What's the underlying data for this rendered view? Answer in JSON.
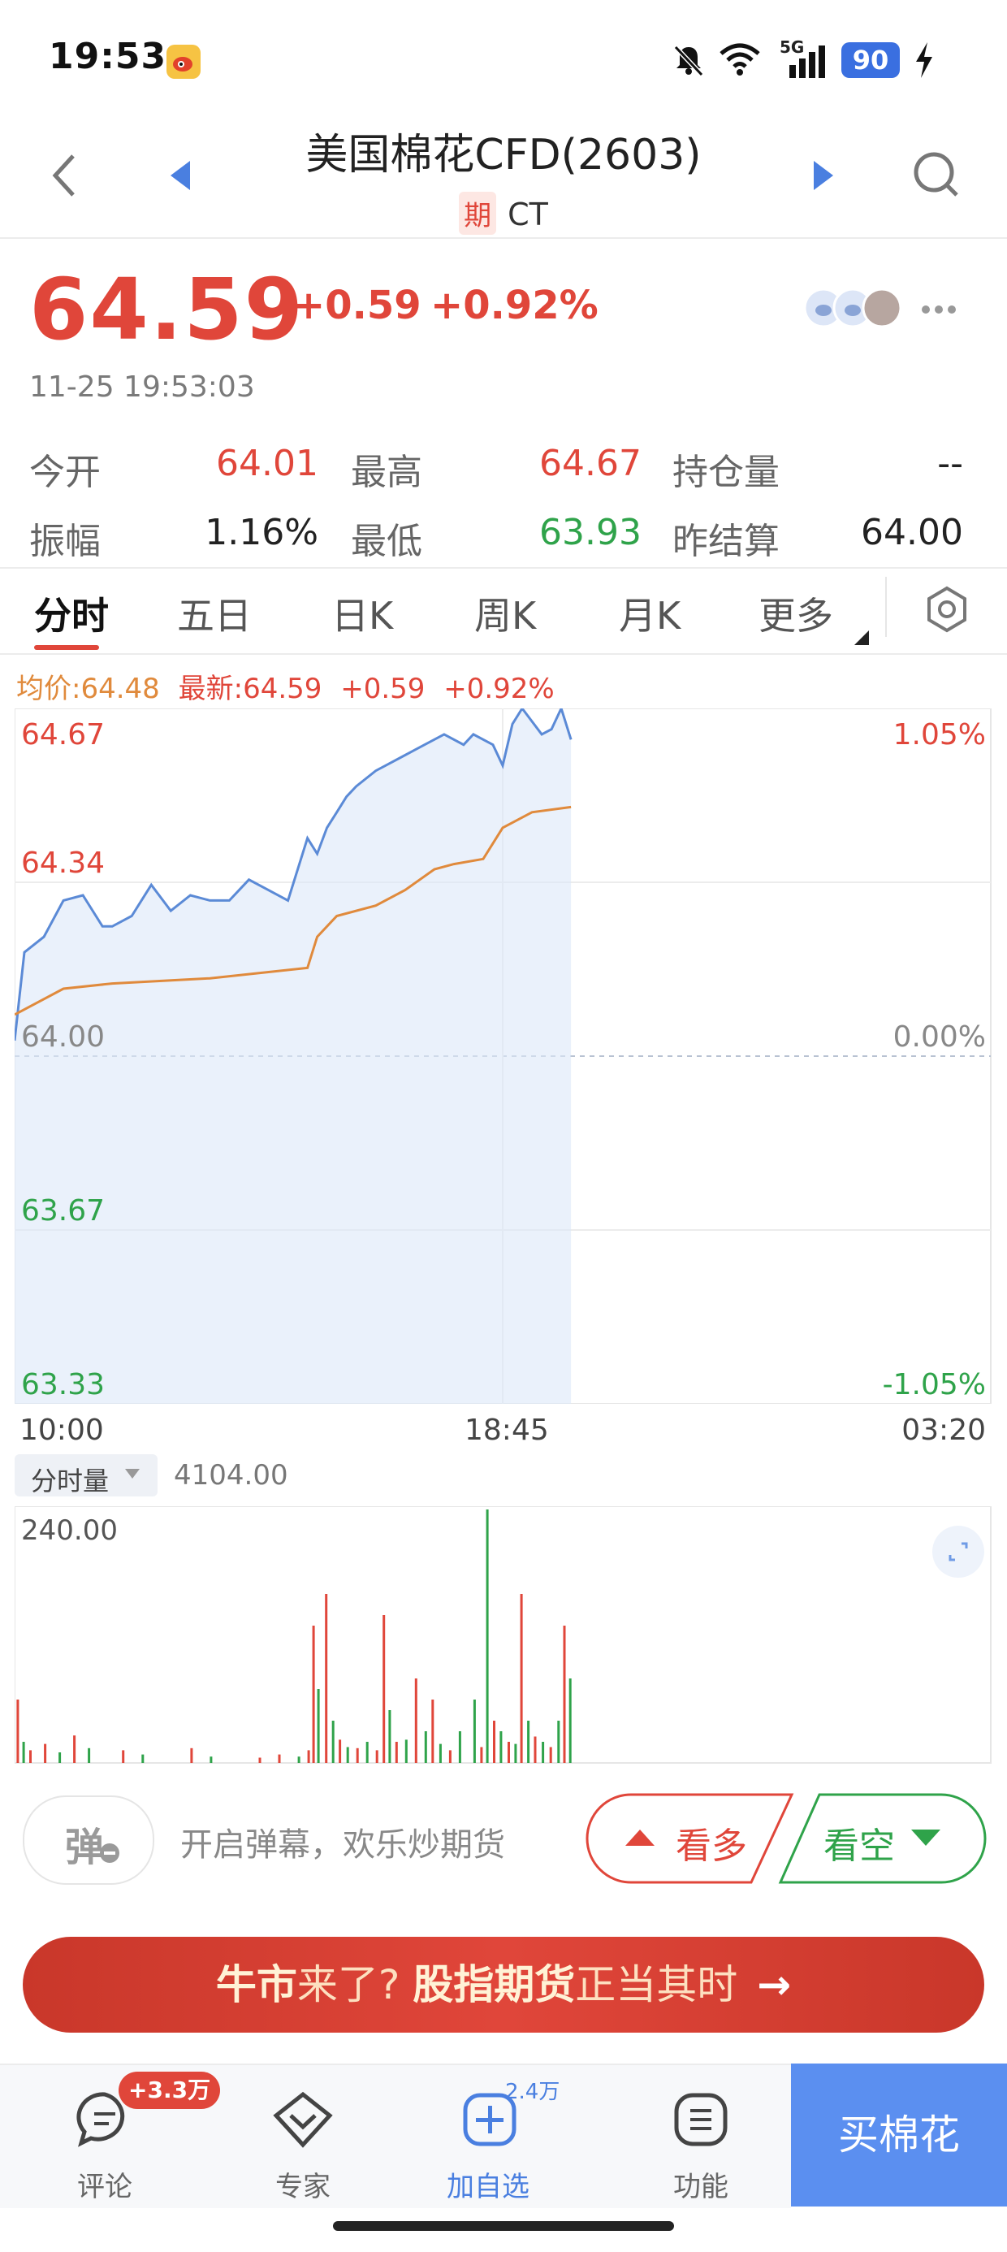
{
  "status_bar": {
    "time": "19:53",
    "network": "5G",
    "battery": "90"
  },
  "header": {
    "title": "美国棉花CFD(2603)",
    "tag": "期",
    "symbol": "CT"
  },
  "quote": {
    "price": "64.59",
    "change": "+0.59",
    "change_pct": "+0.92%",
    "time": "11-25 19:53:03"
  },
  "stats": [
    {
      "label": "今开",
      "value": "64.01",
      "color": "#e0463a"
    },
    {
      "label": "最高",
      "value": "64.67",
      "color": "#e0463a"
    },
    {
      "label": "持仓量",
      "value": "--",
      "color": "#222222"
    },
    {
      "label": "振幅",
      "value": "1.16%",
      "color": "#222222"
    },
    {
      "label": "最低",
      "value": "63.93",
      "color": "#2fa34a"
    },
    {
      "label": "昨结算",
      "value": "64.00",
      "color": "#222222"
    }
  ],
  "tabs": [
    "分时",
    "五日",
    "日K",
    "周K",
    "月K",
    "更多"
  ],
  "chart_info": {
    "avg": "均价:64.48",
    "latest": "最新:64.59",
    "change": "+0.59",
    "change_pct": "+0.92%"
  },
  "chart_data": {
    "type": "line",
    "y_labels_left": [
      "64.67",
      "64.34",
      "64.00",
      "63.67",
      "63.33"
    ],
    "y_labels_right": [
      "1.05%",
      "0.00%",
      "-1.05%"
    ],
    "x_labels": [
      "10:00",
      "18:45",
      "03:20"
    ],
    "ylim": [
      63.33,
      64.67
    ],
    "x_range": [
      0,
      1
    ],
    "series": [
      {
        "color": "#5b8ad6",
        "x": [
          0.0,
          0.01,
          0.03,
          0.05,
          0.07,
          0.09,
          0.1,
          0.12,
          0.14,
          0.16,
          0.18,
          0.2,
          0.22,
          0.24,
          0.26,
          0.28,
          0.3,
          0.31,
          0.32,
          0.33,
          0.34,
          0.35,
          0.37,
          0.38,
          0.4,
          0.42,
          0.44,
          0.46,
          0.47,
          0.49,
          0.5,
          0.51,
          0.52,
          0.54,
          0.55,
          0.56,
          0.57
        ],
        "values": [
          64.03,
          64.2,
          64.23,
          64.3,
          64.31,
          64.25,
          64.25,
          64.27,
          64.33,
          64.28,
          64.31,
          64.3,
          64.3,
          64.34,
          64.32,
          64.3,
          64.42,
          64.39,
          64.44,
          64.47,
          64.5,
          64.52,
          64.55,
          64.56,
          64.58,
          64.6,
          64.62,
          64.6,
          64.62,
          64.6,
          64.56,
          64.64,
          64.67,
          64.62,
          64.63,
          64.67,
          64.61
        ]
      },
      {
        "color": "#e08a3c",
        "x": [
          0.0,
          0.05,
          0.1,
          0.2,
          0.3,
          0.31,
          0.33,
          0.37,
          0.4,
          0.43,
          0.45,
          0.48,
          0.5,
          0.53,
          0.57
        ],
        "values": [
          64.08,
          64.13,
          64.14,
          64.15,
          64.17,
          64.23,
          64.27,
          64.29,
          64.32,
          64.36,
          64.37,
          64.38,
          64.44,
          64.47,
          64.48
        ]
      }
    ]
  },
  "volume": {
    "label": "分时量",
    "value": "4104.00",
    "max_label": "240.00"
  },
  "volume_data": {
    "ylim": [
      0,
      240
    ],
    "bars": [
      {
        "x": 0.002,
        "v": 60,
        "c": "#e0463a"
      },
      {
        "x": 0.008,
        "v": 20,
        "c": "#2fa34a"
      },
      {
        "x": 0.015,
        "v": 12,
        "c": "#e0463a"
      },
      {
        "x": 0.03,
        "v": 18,
        "c": "#e0463a"
      },
      {
        "x": 0.045,
        "v": 10,
        "c": "#2fa34a"
      },
      {
        "x": 0.06,
        "v": 26,
        "c": "#e0463a"
      },
      {
        "x": 0.075,
        "v": 14,
        "c": "#2fa34a"
      },
      {
        "x": 0.11,
        "v": 12,
        "c": "#e0463a"
      },
      {
        "x": 0.13,
        "v": 8,
        "c": "#2fa34a"
      },
      {
        "x": 0.18,
        "v": 14,
        "c": "#e0463a"
      },
      {
        "x": 0.2,
        "v": 6,
        "c": "#2fa34a"
      },
      {
        "x": 0.25,
        "v": 5,
        "c": "#e0463a"
      },
      {
        "x": 0.27,
        "v": 8,
        "c": "#e0463a"
      },
      {
        "x": 0.29,
        "v": 6,
        "c": "#2fa34a"
      },
      {
        "x": 0.3,
        "v": 12,
        "c": "#e0463a"
      },
      {
        "x": 0.305,
        "v": 130,
        "c": "#e0463a"
      },
      {
        "x": 0.31,
        "v": 70,
        "c": "#2fa34a"
      },
      {
        "x": 0.318,
        "v": 160,
        "c": "#e0463a"
      },
      {
        "x": 0.325,
        "v": 40,
        "c": "#2fa34a"
      },
      {
        "x": 0.332,
        "v": 22,
        "c": "#e0463a"
      },
      {
        "x": 0.34,
        "v": 15,
        "c": "#2fa34a"
      },
      {
        "x": 0.35,
        "v": 14,
        "c": "#e0463a"
      },
      {
        "x": 0.36,
        "v": 20,
        "c": "#2fa34a"
      },
      {
        "x": 0.37,
        "v": 12,
        "c": "#e0463a"
      },
      {
        "x": 0.377,
        "v": 140,
        "c": "#e0463a"
      },
      {
        "x": 0.383,
        "v": 50,
        "c": "#2fa34a"
      },
      {
        "x": 0.39,
        "v": 20,
        "c": "#e0463a"
      },
      {
        "x": 0.4,
        "v": 22,
        "c": "#2fa34a"
      },
      {
        "x": 0.41,
        "v": 80,
        "c": "#e0463a"
      },
      {
        "x": 0.42,
        "v": 30,
        "c": "#2fa34a"
      },
      {
        "x": 0.427,
        "v": 60,
        "c": "#e0463a"
      },
      {
        "x": 0.435,
        "v": 18,
        "c": "#2fa34a"
      },
      {
        "x": 0.445,
        "v": 12,
        "c": "#e0463a"
      },
      {
        "x": 0.455,
        "v": 30,
        "c": "#2fa34a"
      },
      {
        "x": 0.47,
        "v": 60,
        "c": "#2fa34a"
      },
      {
        "x": 0.477,
        "v": 15,
        "c": "#e0463a"
      },
      {
        "x": 0.483,
        "v": 240,
        "c": "#2fa34a"
      },
      {
        "x": 0.49,
        "v": 40,
        "c": "#e0463a"
      },
      {
        "x": 0.497,
        "v": 30,
        "c": "#2fa34a"
      },
      {
        "x": 0.505,
        "v": 20,
        "c": "#e0463a"
      },
      {
        "x": 0.512,
        "v": 18,
        "c": "#2fa34a"
      },
      {
        "x": 0.518,
        "v": 160,
        "c": "#e0463a"
      },
      {
        "x": 0.525,
        "v": 40,
        "c": "#2fa34a"
      },
      {
        "x": 0.532,
        "v": 25,
        "c": "#e0463a"
      },
      {
        "x": 0.54,
        "v": 20,
        "c": "#2fa34a"
      },
      {
        "x": 0.548,
        "v": 15,
        "c": "#e0463a"
      },
      {
        "x": 0.556,
        "v": 40,
        "c": "#2fa34a"
      },
      {
        "x": 0.562,
        "v": 130,
        "c": "#e0463a"
      },
      {
        "x": 0.568,
        "v": 80,
        "c": "#2fa34a"
      }
    ]
  },
  "danmu": {
    "icon_label": "弹",
    "text": "开启弹幕，欢乐炒期货"
  },
  "bull_button": "看多",
  "bear_button": "看空",
  "banner": {
    "part1": "牛市",
    "part2": "来了? ",
    "part3": "股指期货",
    "part4": "正当其时",
    "arrow": "→"
  },
  "bottom_nav": [
    {
      "label": "评论",
      "badge": "+3.3万"
    },
    {
      "label": "专家",
      "badge": ""
    },
    {
      "label": "加自选",
      "badge": "2.4万"
    },
    {
      "label": "功能",
      "badge": ""
    }
  ],
  "buy_button": "买棉花",
  "colors": {
    "red": "#e0463a",
    "green": "#2fa34a",
    "blue": "#5b8ad6",
    "orange": "#e08a3c"
  }
}
